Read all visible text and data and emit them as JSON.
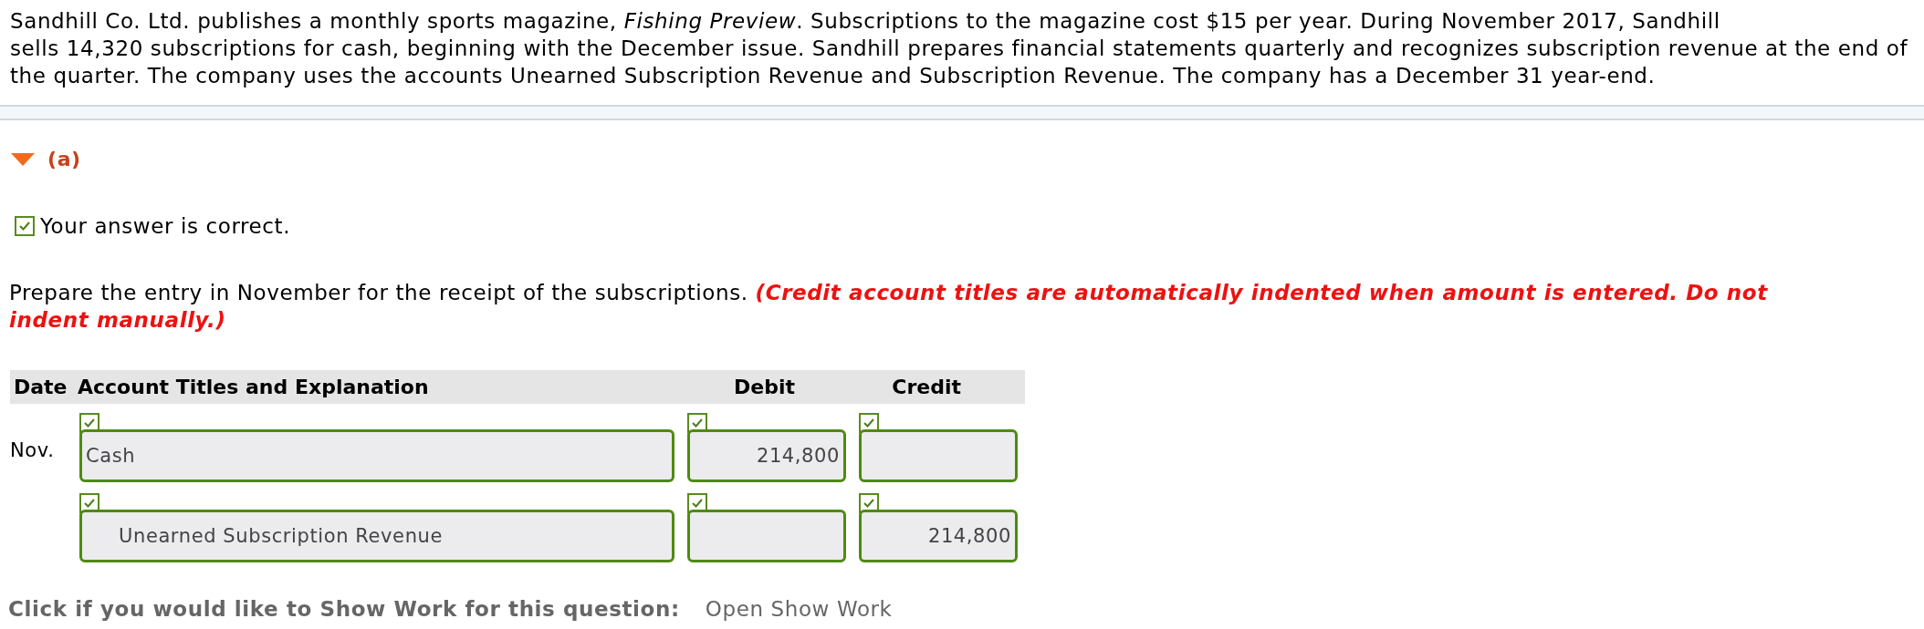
{
  "problem": {
    "lines": [
      "Sandhill Co. Ltd. publishes a monthly sports magazine, *Fishing Preview*. Subscriptions to the magazine cost $15 per year. During November 2017, Sandhill",
      "sells 14,320 subscriptions for cash, beginning with the December issue. Sandhill prepares financial statements quarterly and recognizes subscription revenue at the end of",
      "the quarter. The company uses the accounts Unearned Subscription Revenue and Subscription Revenue. The company has a December 31 year-end."
    ]
  },
  "part": {
    "label": "(a)",
    "expanded": true
  },
  "result": {
    "correct": true,
    "message": "Your answer is correct."
  },
  "instruction": {
    "text": "Prepare the entry in November for the receipt of the subscriptions.",
    "note": "(Credit account titles are automatically indented when amount is entered. Do not indent manually.)"
  },
  "table": {
    "columns": [
      "Date",
      "Account Titles and Explanation",
      "Debit",
      "Credit"
    ],
    "rows": [
      {
        "date": "Nov.",
        "account": "Cash",
        "indented": false,
        "debit": "214,800",
        "credit": "",
        "account_correct": true,
        "debit_correct": true,
        "credit_correct": true
      },
      {
        "date": "",
        "account": "Unearned Subscription Revenue",
        "indented": true,
        "debit": "",
        "credit": "214,800",
        "account_correct": true,
        "debit_correct": true,
        "credit_correct": true
      }
    ]
  },
  "show_work": {
    "prompt": "Click if you would like to Show Work for this question:",
    "link": "Open Show Work"
  }
}
